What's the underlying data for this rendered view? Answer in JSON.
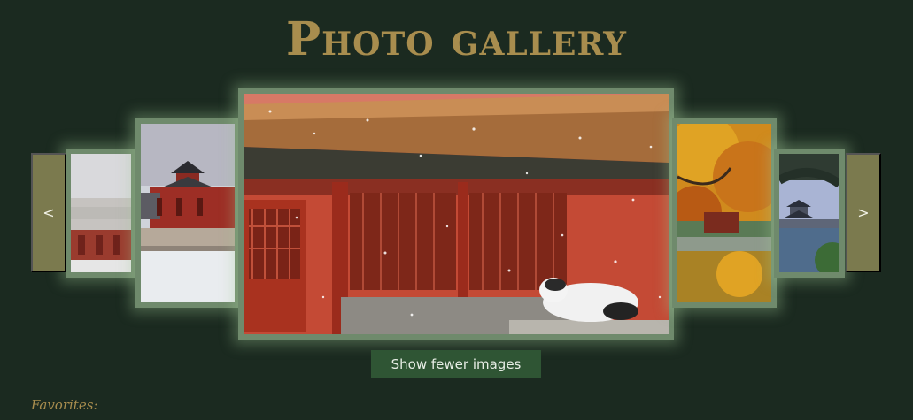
{
  "header": {
    "title": "Photo gallery"
  },
  "carousel": {
    "prev_label": "<",
    "next_label": ">",
    "images": [
      {
        "id": "palace-red-wall"
      },
      {
        "id": "snowy-pagoda"
      },
      {
        "id": "cat-snow-pavilion"
      },
      {
        "id": "autumn-tree"
      },
      {
        "id": "lake-pavilion"
      }
    ]
  },
  "toggle_button": {
    "label": "Show fewer images"
  },
  "favorites": {
    "label": "Favorites:"
  },
  "colors": {
    "background": "#1b2a20",
    "title": "#a88d4e",
    "nav": "#7b7a4e",
    "button": "#2f5534"
  }
}
